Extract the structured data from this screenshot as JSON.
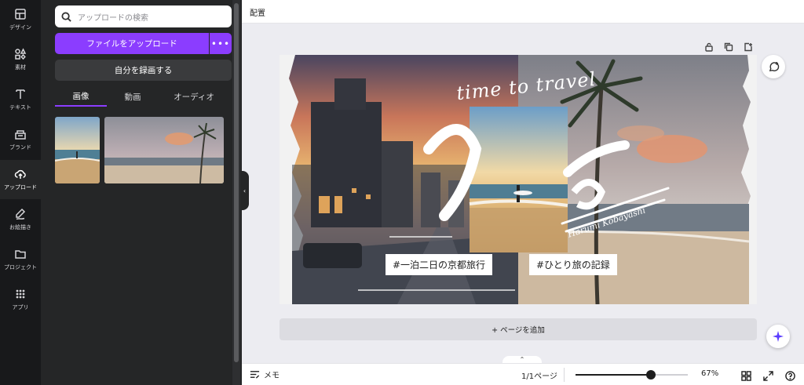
{
  "rail": {
    "items": [
      {
        "label": "デザイン",
        "icon": "layout-icon"
      },
      {
        "label": "素材",
        "icon": "shapes-icon"
      },
      {
        "label": "テキスト",
        "icon": "text-icon"
      },
      {
        "label": "ブランド",
        "icon": "brand-icon"
      },
      {
        "label": "アップロード",
        "icon": "upload-cloud-icon"
      },
      {
        "label": "お絵描き",
        "icon": "draw-icon"
      },
      {
        "label": "プロジェクト",
        "icon": "folder-icon"
      },
      {
        "label": "アプリ",
        "icon": "apps-grid-icon"
      }
    ],
    "active": "アップロード"
  },
  "panel": {
    "search_placeholder": "アップロードの検索",
    "upload_label": "ファイルをアップロード",
    "more_label": "•••",
    "record_label": "自分を録画する",
    "tabs": [
      {
        "label": "画像"
      },
      {
        "label": "動画"
      },
      {
        "label": "オーディオ"
      }
    ],
    "active_tab": "画像"
  },
  "topbar": {
    "title": "配置"
  },
  "design": {
    "script_title": "time to travel",
    "script_name": "Harumi Kobayashi",
    "tag_left": "#一泊二日の京都旅行",
    "tag_right": "#ひとり旅の記録"
  },
  "canvas": {
    "add_page_label": "+ ページを追加",
    "expand_label": "⌃"
  },
  "bottombar": {
    "notes_label": "メモ",
    "pages_label": "1/1ページ",
    "zoom_label": "67%",
    "zoom_fraction": 0.67
  },
  "colors": {
    "accent": "#8b3dff",
    "rail_bg": "#18191b",
    "panel_bg": "#252627"
  }
}
